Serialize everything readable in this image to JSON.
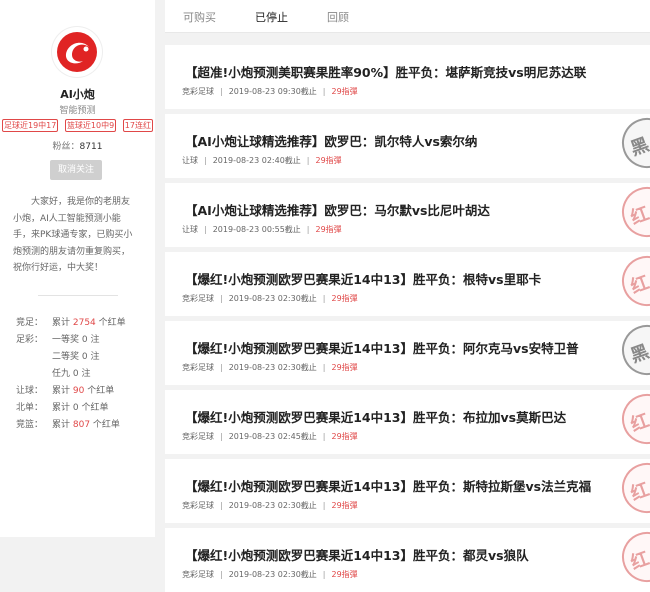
{
  "profile": {
    "name": "AI小炮",
    "subtitle": "智能预测",
    "badges": [
      "足球近19中17",
      "篮球近10中9",
      "17连红"
    ],
    "fans_label": "粉丝：",
    "fans_count": "8711",
    "unfollow_label": "取消关注",
    "bio": "大家好，我是你的老朋友小炮，AI人工智能预测小能手，来PK球通专家，已购买小炮预测的朋友请勿重复购买，祝你行好运，中大奖！"
  },
  "stats": [
    {
      "label": "竞足：",
      "prefix": "累计 ",
      "num": "2754",
      "suffix": " 个红单"
    },
    {
      "label": "足彩：",
      "prefix": "一等奖 0 注",
      "num": "",
      "suffix": ""
    },
    {
      "label": "",
      "prefix": "二等奖 0 注",
      "num": "",
      "suffix": ""
    },
    {
      "label": "",
      "prefix": "任九 0 注",
      "num": "",
      "suffix": ""
    },
    {
      "label": "让球：",
      "prefix": "累计 ",
      "num": "90",
      "suffix": " 个红单"
    },
    {
      "label": "北单：",
      "prefix": "累计 0 个红单",
      "num": "",
      "suffix": ""
    },
    {
      "label": "竞篮：",
      "prefix": "累计 ",
      "num": "807",
      "suffix": " 个红单"
    }
  ],
  "tabs": [
    "可购买",
    "已停止",
    "回顾"
  ],
  "active_tab": 1,
  "items": [
    {
      "title": "【超准!小炮预测美职赛果胜率90%】胜平负：堪萨斯竞技vs明尼苏达联",
      "category": "竞彩足球",
      "time": "2019-08-23 09:30截止",
      "price": "29指彈",
      "stamp": ""
    },
    {
      "title": "【AI小炮让球精选推荐】欧罗巴：凯尔特人vs索尔纳",
      "category": "让球",
      "time": "2019-08-23 02:40截止",
      "price": "29指彈",
      "stamp": "黑"
    },
    {
      "title": "【AI小炮让球精选推荐】欧罗巴：马尔默vs比尼叶胡达",
      "category": "让球",
      "time": "2019-08-23 00:55截止",
      "price": "29指彈",
      "stamp": "红"
    },
    {
      "title": "【爆红!小炮预测欧罗巴赛果近14中13】胜平负：根特vs里耶卡",
      "category": "竞彩足球",
      "time": "2019-08-23 02:30截止",
      "price": "29指彈",
      "stamp": "红"
    },
    {
      "title": "【爆红!小炮预测欧罗巴赛果近14中13】胜平负：阿尔克马vs安特卫普",
      "category": "竞彩足球",
      "time": "2019-08-23 02:30截止",
      "price": "29指彈",
      "stamp": "黑"
    },
    {
      "title": "【爆红!小炮预测欧罗巴赛果近14中13】胜平负：布拉加vs莫斯巴达",
      "category": "竞彩足球",
      "time": "2019-08-23 02:45截止",
      "price": "29指彈",
      "stamp": "红"
    },
    {
      "title": "【爆红!小炮预测欧罗巴赛果近14中13】胜平负：斯特拉斯堡vs法兰克福",
      "category": "竞彩足球",
      "time": "2019-08-23 02:30截止",
      "price": "29指彈",
      "stamp": "红"
    },
    {
      "title": "【爆红!小炮预测欧罗巴赛果近14中13】胜平负：都灵vs狼队",
      "category": "竞彩足球",
      "time": "2019-08-23 02:30截止",
      "price": "29指彈",
      "stamp": "红"
    }
  ],
  "colors": {
    "accent": "#e04848",
    "stamp_red": "#e8a0a0",
    "stamp_black": "#999999"
  }
}
